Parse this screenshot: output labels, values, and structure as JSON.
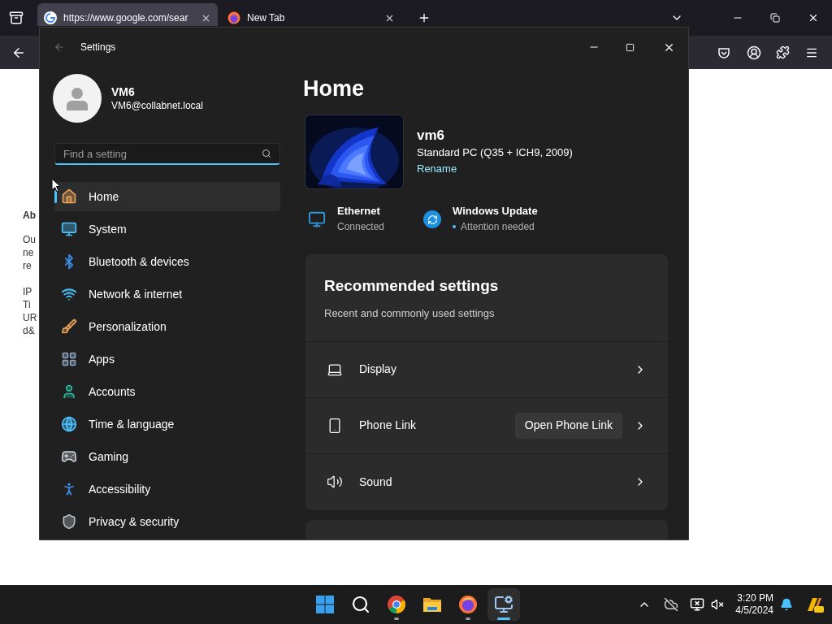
{
  "browser": {
    "tabs": [
      {
        "title": "https://www.google.com/sear",
        "kind": "google",
        "selected": true
      },
      {
        "title": "New Tab",
        "kind": "firefox",
        "selected": false
      }
    ],
    "page_fragments": [
      "Ab",
      "Ou",
      "ne",
      "re",
      "IP",
      "Ti",
      "UR",
      "d&"
    ]
  },
  "settings": {
    "title": "Settings",
    "user": {
      "name": "VM6",
      "email": "VM6@collabnet.local"
    },
    "search": {
      "placeholder": "Find a setting"
    },
    "nav": [
      {
        "label": "Home",
        "kind": "home",
        "selected": true
      },
      {
        "label": "System",
        "kind": "system",
        "selected": false
      },
      {
        "label": "Bluetooth & devices",
        "kind": "bluetooth",
        "selected": false
      },
      {
        "label": "Network & internet",
        "kind": "wifi",
        "selected": false
      },
      {
        "label": "Personalization",
        "kind": "brush",
        "selected": false
      },
      {
        "label": "Apps",
        "kind": "apps",
        "selected": false
      },
      {
        "label": "Accounts",
        "kind": "accounts",
        "selected": false
      },
      {
        "label": "Time & language",
        "kind": "time",
        "selected": false
      },
      {
        "label": "Gaming",
        "kind": "gaming",
        "selected": false
      },
      {
        "label": "Accessibility",
        "kind": "accessibility",
        "selected": false
      },
      {
        "label": "Privacy & security",
        "kind": "privacy",
        "selected": false
      }
    ],
    "page_title": "Home",
    "device": {
      "name": "vm6",
      "model": "Standard PC (Q35 + ICH9, 2009)",
      "rename": "Rename"
    },
    "status": [
      {
        "kind": "ethernet",
        "title": "Ethernet",
        "subtitle": "Connected",
        "alert": false
      },
      {
        "kind": "update",
        "title": "Windows Update",
        "subtitle": "Attention needed",
        "alert": true
      }
    ],
    "recommended": {
      "title": "Recommended settings",
      "subtitle": "Recent and commonly used settings",
      "items": [
        {
          "kind": "display",
          "label": "Display"
        },
        {
          "kind": "phone",
          "label": "Phone Link",
          "action": "Open Phone Link"
        },
        {
          "kind": "sound",
          "label": "Sound"
        }
      ]
    }
  },
  "taskbar": {
    "apps": [
      {
        "kind": "start",
        "running": false,
        "selected": false
      },
      {
        "kind": "search",
        "running": false,
        "selected": false
      },
      {
        "kind": "chrome",
        "running": true,
        "selected": false
      },
      {
        "kind": "explorer",
        "running": false,
        "selected": false
      },
      {
        "kind": "firefox",
        "running": true,
        "selected": false
      },
      {
        "kind": "settings",
        "running": true,
        "selected": true
      }
    ],
    "clock": {
      "time": "3:20 PM",
      "date": "4/5/2024"
    }
  }
}
